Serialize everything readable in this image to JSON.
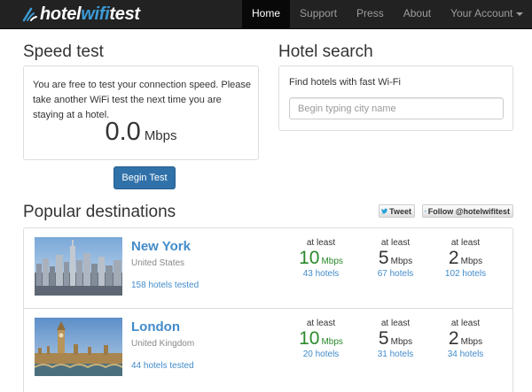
{
  "brand": {
    "part1": "hotel",
    "part2": "wifi",
    "part3": "test"
  },
  "nav": {
    "items": [
      {
        "label": "Home",
        "active": true
      },
      {
        "label": "Support",
        "active": false
      },
      {
        "label": "Press",
        "active": false
      },
      {
        "label": "About",
        "active": false
      },
      {
        "label": "Your Account",
        "active": false
      }
    ]
  },
  "speed_test": {
    "heading": "Speed test",
    "description": "You are free to test your connection speed. Please take another WiFi test the next time you are staying at a hotel.",
    "value": "0.0",
    "unit": "Mbps",
    "button": "Begin Test"
  },
  "hotel_search": {
    "heading": "Hotel search",
    "label": "Find hotels with fast Wi-Fi",
    "placeholder": "Begin typing city name"
  },
  "popular": {
    "heading": "Popular destinations",
    "tweet_label": "Tweet",
    "follow_label": "Follow @hotelwifitest",
    "destinations": [
      {
        "city": "New York",
        "country": "United States",
        "tested": "158 hotels tested",
        "speeds": [
          {
            "prefix": "at least",
            "value": "10",
            "unit": "Mbps",
            "hotels": "43 hotels"
          },
          {
            "prefix": "at least",
            "value": "5",
            "unit": "Mbps",
            "hotels": "67 hotels"
          },
          {
            "prefix": "at least",
            "value": "2",
            "unit": "Mbps",
            "hotels": "102 hotels"
          }
        ]
      },
      {
        "city": "London",
        "country": "United Kingdom",
        "tested": "44 hotels tested",
        "speeds": [
          {
            "prefix": "at least",
            "value": "10",
            "unit": "Mbps",
            "hotels": "20 hotels"
          },
          {
            "prefix": "at least",
            "value": "5",
            "unit": "Mbps",
            "hotels": "31 hotels"
          },
          {
            "prefix": "at least",
            "value": "2",
            "unit": "Mbps",
            "hotels": "34 hotels"
          }
        ]
      }
    ]
  },
  "colors": {
    "navbar": "#222222",
    "link": "#428bca",
    "primary_button": "#3071a9",
    "speed_10": "#2a8a2a",
    "speed_other": "#333333"
  }
}
